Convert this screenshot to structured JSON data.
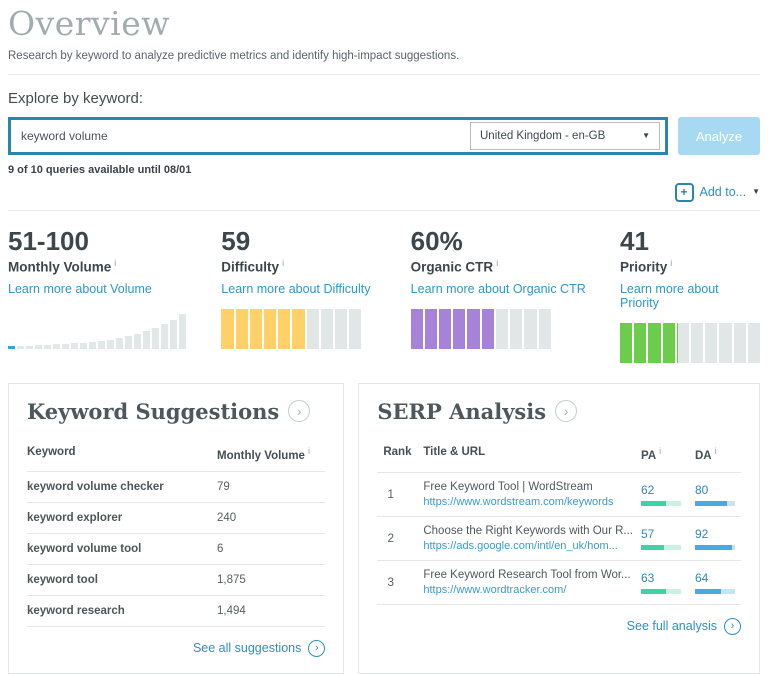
{
  "icons": {
    "info": "i",
    "plus": "+",
    "chevron": "›",
    "caret_down": "▼"
  },
  "colors": {
    "accent_blue": "#2e8fc5",
    "search_border": "#2a86af",
    "analyze_bg": "#a7daf2",
    "difficulty_yellow": "#ffd167",
    "ctr_purple": "#a782d9",
    "priority_green": "#6ccc4b",
    "segment_gray": "#e1e7e7",
    "histogram_gray": "#e2e8e8",
    "histogram_highlight": "#2aa9e0",
    "pa_fill": "#3ed3a4",
    "pa_track": "#c9f2e2",
    "da_fill": "#49aae2",
    "da_track": "#bfe7f8"
  },
  "header": {
    "title": "Overview",
    "subtitle": "Research by keyword to analyze predictive metrics and identify high-impact suggestions."
  },
  "explore": {
    "label": "Explore by keyword:",
    "input_value": "keyword volume",
    "locale_selected": "United Kingdom - en-GB",
    "analyze_label": "Analyze",
    "queries_note": "9 of 10 queries available until 08/01",
    "add_to_label": "Add to..."
  },
  "metrics": {
    "volume": {
      "value": "51-100",
      "label": "Monthly Volume",
      "link": "Learn more about Volume",
      "histogram": [
        3,
        3,
        3,
        4,
        4,
        5,
        5,
        6,
        6,
        7,
        8,
        9,
        11,
        13,
        15,
        18,
        21,
        25,
        29,
        35
      ],
      "highlight_index": 0
    },
    "difficulty": {
      "value": "59",
      "label": "Difficulty",
      "link": "Learn more about Difficulty",
      "segments": 10,
      "filled": 6,
      "color": "#ffd167"
    },
    "organic_ctr": {
      "value": "60%",
      "label": "Organic CTR",
      "link": "Learn more about Organic CTR",
      "segments": 10,
      "filled": 6,
      "color": "#a782d9"
    },
    "priority": {
      "value": "41",
      "label": "Priority",
      "link": "Learn more about Priority",
      "segments": 10,
      "filled": 4.1,
      "color": "#6ccc4b"
    }
  },
  "suggestions": {
    "title": "Keyword Suggestions",
    "columns": [
      "Keyword",
      "Monthly Volume"
    ],
    "rows": [
      [
        "keyword volume checker",
        "79"
      ],
      [
        "keyword explorer",
        "240"
      ],
      [
        "keyword volume tool",
        "6"
      ],
      [
        "keyword tool",
        "1,875"
      ],
      [
        "keyword research",
        "1,494"
      ]
    ],
    "footer_link": "See all suggestions"
  },
  "serp": {
    "title": "SERP Analysis",
    "columns": [
      "Rank",
      "Title & URL",
      "PA",
      "DA"
    ],
    "rows": [
      {
        "rank": "1",
        "title": "Free Keyword Tool | WordStream",
        "url": "https://www.wordstream.com/keywords",
        "pa": 62,
        "da": 80
      },
      {
        "rank": "2",
        "title": "Choose the Right Keywords with Our R...",
        "url": "https://ads.google.com/intl/en_uk/hom...",
        "pa": 57,
        "da": 92
      },
      {
        "rank": "3",
        "title": "Free Keyword Research Tool from Wor...",
        "url": "https://www.wordtracker.com/",
        "pa": 63,
        "da": 64
      }
    ],
    "footer_link": "See full analysis"
  }
}
